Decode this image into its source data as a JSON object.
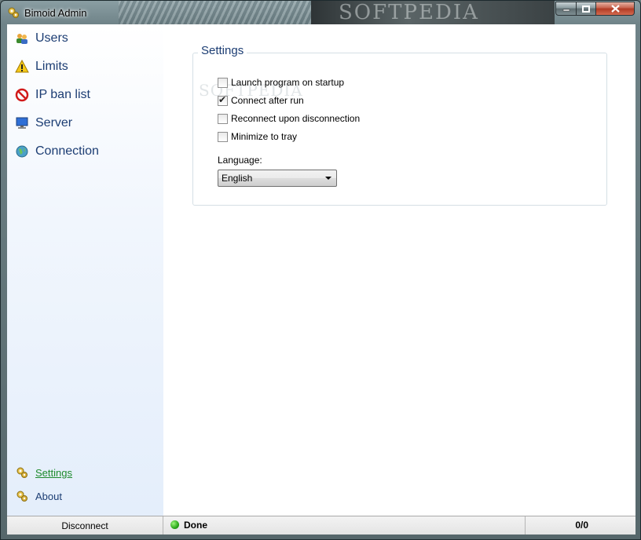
{
  "window": {
    "title": "Bimoid Admin",
    "watermark": "SOFTPEDIA"
  },
  "nav": {
    "items": [
      {
        "label": "Users",
        "icon": "users-icon"
      },
      {
        "label": "Limits",
        "icon": "warning-icon"
      },
      {
        "label": "IP ban list",
        "icon": "ban-icon"
      },
      {
        "label": "Server",
        "icon": "monitor-icon"
      },
      {
        "label": "Connection",
        "icon": "globe-icon"
      }
    ],
    "settings_label": "Settings",
    "about_label": "About"
  },
  "settings": {
    "title": "Settings",
    "options": [
      {
        "label": "Launch program on startup",
        "checked": false
      },
      {
        "label": "Connect after run",
        "checked": true
      },
      {
        "label": "Reconnect upon disconnection",
        "checked": false
      },
      {
        "label": "Minimize to tray",
        "checked": false
      }
    ],
    "language_label": "Language:",
    "language_value": "English"
  },
  "statusbar": {
    "disconnect_label": "Disconnect",
    "status": "Done",
    "count": "0/0"
  },
  "colors": {
    "accent": "#1c3d73",
    "link_active": "#1d8a2c",
    "status_ok": "#2aa81a"
  }
}
